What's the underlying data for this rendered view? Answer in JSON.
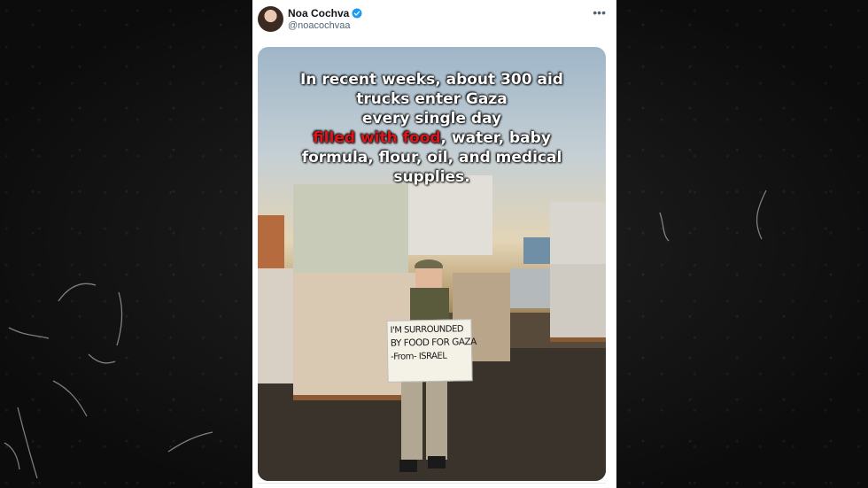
{
  "tweet": {
    "author": {
      "display_name": "Noa Cochva",
      "handle": "@noacochvaa",
      "verified": true,
      "avatar_icon": "profile-photo"
    },
    "more_icon": "more-options-icon",
    "media": {
      "overlay_lines": [
        "In recent weeks, about 300 aid",
        "trucks enter Gaza",
        "every single day"
      ],
      "overlay_highlight": "filled with food",
      "overlay_after_highlight": ", water, baby",
      "overlay_lines_end": [
        "formula, flour, oil, and medical",
        "supplies."
      ],
      "sign_lines": [
        "I'M SURROUNDED",
        "BY FOOD FOR GAZA",
        "-From- ISRAEL"
      ]
    }
  },
  "colors": {
    "highlight": "#e0141b",
    "verified": "#1d9bf0",
    "card_bg": "#ffffff",
    "backdrop": "#111112"
  }
}
